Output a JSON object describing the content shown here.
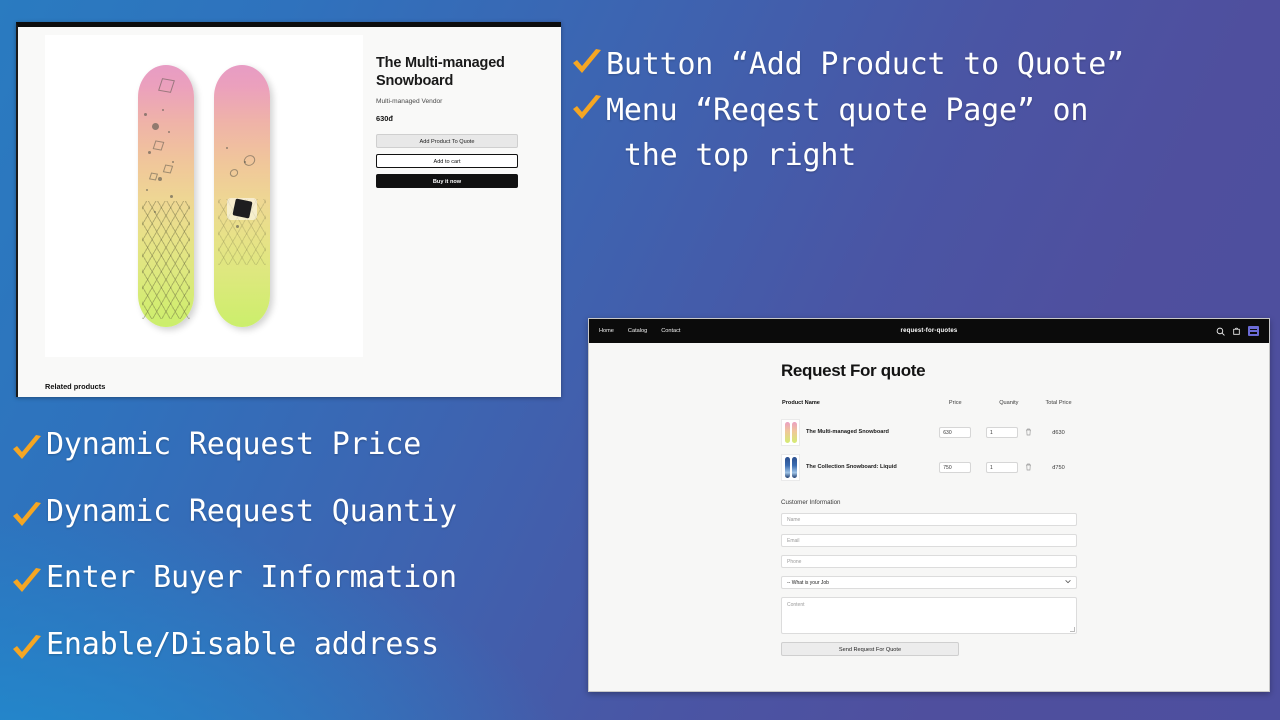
{
  "theme": {
    "bg_gradient_from": "#2a7bc0",
    "bg_gradient_to": "#4f4f9e",
    "bg_accent_bottom_left": "#1e8ed0",
    "check_color": "#f5a623",
    "text_color": "#ffffff"
  },
  "product_screenshot": {
    "title": "The Multi-managed Snowboard",
    "vendor": "Multi-managed Vendor",
    "price": "630đ",
    "buttons": {
      "add_to_quote": "Add Product To Quote",
      "add_to_cart": "Add to cart",
      "buy_it_now": "Buy it now"
    },
    "related_heading": "Related products"
  },
  "rfq_screenshot": {
    "header": {
      "nav": [
        "Home",
        "Catalog",
        "Contact"
      ],
      "brand": "request-for-quotes",
      "icons": [
        "search-icon",
        "cart-icon",
        "app-embed-icon"
      ]
    },
    "page_title": "Request For quote",
    "table": {
      "columns": [
        "Product Name",
        "Price",
        "Quanity",
        "Total Price"
      ],
      "rows": [
        {
          "name": "The Multi-managed Snowboard",
          "price": "630",
          "quantity": "1",
          "total": "đ630",
          "thumb": "snowboard-pink-yellow"
        },
        {
          "name": "The Collection Snowboard: Liquid",
          "price": "750",
          "quantity": "1",
          "total": "đ750",
          "thumb": "snowboard-blue"
        }
      ]
    },
    "customer_section_title": "Customer Information",
    "form": {
      "name_placeholder": "Name",
      "email_placeholder": "Email",
      "phone_placeholder": "Phone",
      "job_selected": "-- What is your Job",
      "content_placeholder": "Content",
      "submit_label": "Send Request For Quote"
    }
  },
  "callouts": {
    "right": [
      "Button “Add Product to Quote”",
      "Menu “Reqest quote Page” on\n the top right"
    ],
    "left": [
      "Dynamic Request Price",
      "Dynamic Request Quantiy",
      "Enter Buyer Information",
      "Enable/Disable address"
    ]
  }
}
